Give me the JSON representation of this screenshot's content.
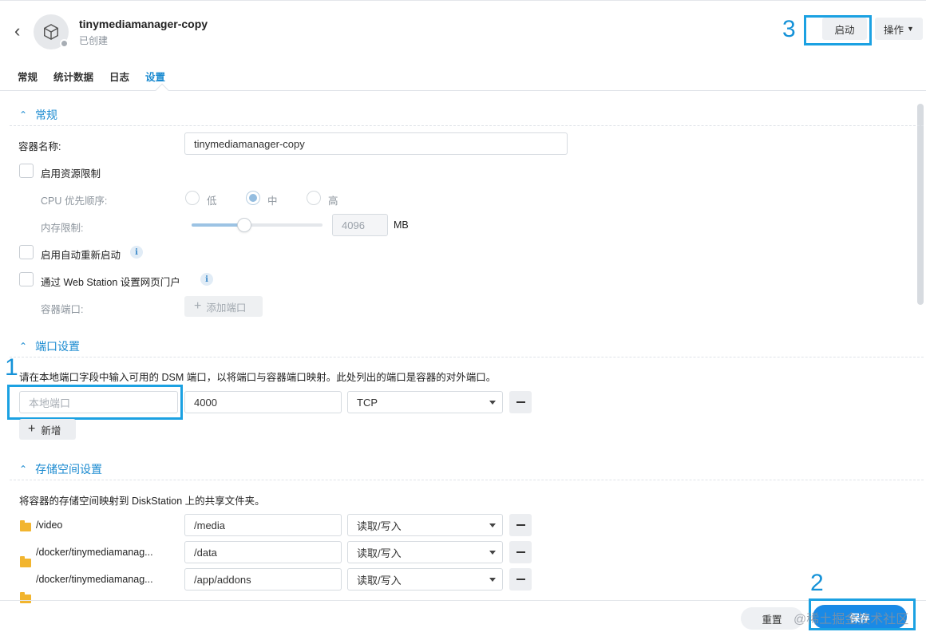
{
  "header": {
    "title": "tinymediamanager-copy",
    "status": "已创建",
    "start_label": "启动",
    "action_label": "操作"
  },
  "tabs": [
    {
      "label": "常规"
    },
    {
      "label": "统计数据"
    },
    {
      "label": "日志"
    },
    {
      "label": "设置"
    }
  ],
  "general": {
    "section_title": "常规",
    "container_name_label": "容器名称:",
    "container_name_value": "tinymediamanager-copy",
    "resource_limit_label": "启用资源限制",
    "cpu_label": "CPU 优先顺序:",
    "cpu_options": [
      "低",
      "中",
      "高"
    ],
    "memory_label": "内存限制:",
    "memory_value": "4096",
    "memory_unit": "MB",
    "memory_slider_fraction": 0.4,
    "auto_restart_label": "启用自动重新启动",
    "webstation_label": "通过 Web Station 设置网页门户",
    "container_port_label": "容器端口:",
    "add_port_label": "添加端口"
  },
  "ports": {
    "section_title": "端口设置",
    "description": "请在本地端口字段中输入可用的 DSM 端口，以将端口与容器端口映射。此处列出的端口是容器的对外端口。",
    "local_port_placeholder": "本地端口",
    "container_port_value": "4000",
    "protocol": "TCP",
    "add_label": "新增"
  },
  "storage": {
    "section_title": "存储空间设置",
    "description": "将容器的存储空间映射到 DiskStation 上的共享文件夹。",
    "rows": [
      {
        "folder": "/video",
        "mount": "/media",
        "mode": "读取/写入"
      },
      {
        "folder": "/docker/tinymediamanag...",
        "mount": "/data",
        "mode": "读取/写入"
      },
      {
        "folder": "/docker/tinymediamanag...",
        "mount": "/app/addons",
        "mode": "读取/写入"
      }
    ]
  },
  "footer": {
    "reset_label": "重置",
    "save_label": "保存",
    "watermark": "@稀土掘金技术社区"
  },
  "annotations": {
    "n1": "1",
    "n2": "2",
    "n3": "3"
  },
  "colors": {
    "accent": "#1a8ad0",
    "highlight": "#1ba1e2",
    "save_button": "#1a8ae6"
  }
}
